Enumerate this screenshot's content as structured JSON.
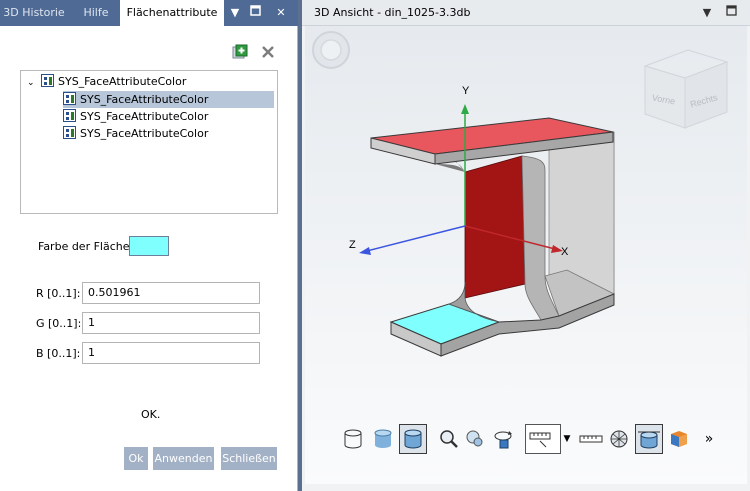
{
  "left_panel": {
    "tabs": [
      "3D Historie",
      "Hilfe",
      "Flächenattribute"
    ],
    "tree": {
      "root_label": "SYS_FaceAttributeColor",
      "children": [
        "SYS_FaceAttributeColor",
        "SYS_FaceAttributeColor",
        "SYS_FaceAttributeColor"
      ],
      "selected_index": 0
    },
    "face_color_label": "Farbe der Fläche:",
    "face_color": "#80ffff",
    "fields": {
      "r_label": "R [0..1]:",
      "r_value": "0.501961",
      "g_label": "G [0..1]:",
      "g_value": "1",
      "b_label": "B [0..1]:",
      "b_value": "1"
    },
    "status": "OK.",
    "buttons": {
      "ok": "Ok",
      "apply": "Anwenden",
      "close": "Schließen"
    }
  },
  "right_panel": {
    "title": "3D Ansicht - din_1025-3.3db",
    "view_cube": {
      "front": "Vorne",
      "right": "Rechts"
    },
    "axes": {
      "x": "X",
      "y": "Y",
      "z": "Z"
    },
    "toolbar_overflow": "»"
  },
  "colors": {
    "tab_bar": "#4f6a94",
    "selection": "#b7c7d9",
    "button": "#a2b1c5",
    "top_face": "#e7575d",
    "web_face": "#a31414",
    "cyan_face": "#80ffff"
  }
}
